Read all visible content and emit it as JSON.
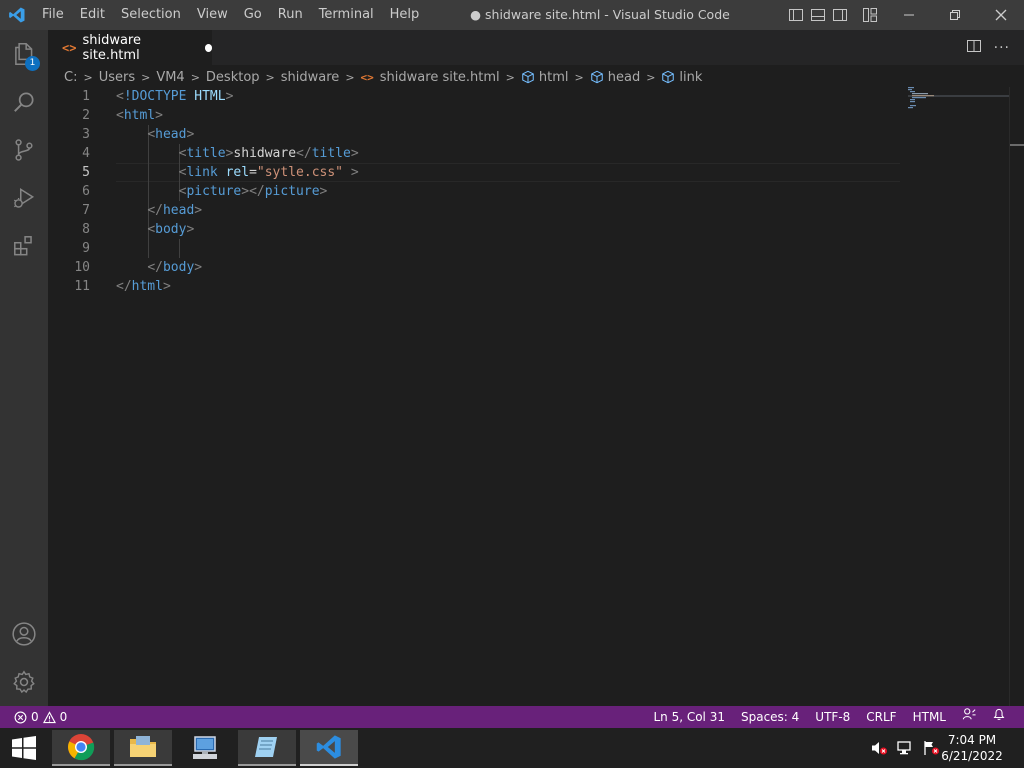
{
  "window": {
    "title": "● shidware site.html - Visual Studio Code",
    "menu": [
      "File",
      "Edit",
      "Selection",
      "View",
      "Go",
      "Run",
      "Terminal",
      "Help"
    ]
  },
  "activity_bar": {
    "explorer_badge": "1"
  },
  "tabs": [
    {
      "label": "shidware site.html",
      "icon": "<>"
    }
  ],
  "breadcrumb": {
    "path": [
      "C:",
      "Users",
      "VM4",
      "Desktop",
      "shidware"
    ],
    "file": "shidware site.html",
    "file_icon": "<>",
    "symbols": [
      "html",
      "head",
      "link"
    ]
  },
  "editor": {
    "active_line": 5,
    "lines": [
      {
        "n": "1",
        "tokens": [
          [
            "t-punct",
            "<"
          ],
          [
            "t-tag",
            "!DOCTYPE "
          ],
          [
            "t-attr",
            "HTML"
          ],
          [
            "t-punct",
            ">"
          ]
        ]
      },
      {
        "n": "2",
        "tokens": [
          [
            "t-punct",
            "<"
          ],
          [
            "t-tag",
            "html"
          ],
          [
            "t-punct",
            ">"
          ]
        ]
      },
      {
        "n": "3",
        "tokens": [
          [
            "t-text",
            "    "
          ],
          [
            "t-punct",
            "<"
          ],
          [
            "t-tag",
            "head"
          ],
          [
            "t-punct",
            ">"
          ]
        ]
      },
      {
        "n": "4",
        "tokens": [
          [
            "t-text",
            "        "
          ],
          [
            "t-punct",
            "<"
          ],
          [
            "t-tag",
            "title"
          ],
          [
            "t-punct",
            ">"
          ],
          [
            "t-text",
            "shidware"
          ],
          [
            "t-punct",
            "</"
          ],
          [
            "t-tag",
            "title"
          ],
          [
            "t-punct",
            ">"
          ]
        ]
      },
      {
        "n": "5",
        "tokens": [
          [
            "t-text",
            "        "
          ],
          [
            "t-punct",
            "<"
          ],
          [
            "t-tag",
            "link "
          ],
          [
            "t-attr",
            "rel"
          ],
          [
            "t-text",
            "="
          ],
          [
            "t-str",
            "\"sytle.css\""
          ],
          [
            "t-text",
            " "
          ],
          [
            "t-punct",
            ">"
          ]
        ]
      },
      {
        "n": "6",
        "tokens": [
          [
            "t-text",
            "        "
          ],
          [
            "t-punct",
            "<"
          ],
          [
            "t-tag",
            "picture"
          ],
          [
            "t-punct",
            "></"
          ],
          [
            "t-tag",
            "picture"
          ],
          [
            "t-punct",
            ">"
          ]
        ]
      },
      {
        "n": "7",
        "tokens": [
          [
            "t-text",
            "    "
          ],
          [
            "t-punct",
            "</"
          ],
          [
            "t-tag",
            "head"
          ],
          [
            "t-punct",
            ">"
          ]
        ]
      },
      {
        "n": "8",
        "tokens": [
          [
            "t-text",
            "    "
          ],
          [
            "t-punct",
            "<"
          ],
          [
            "t-tag",
            "body"
          ],
          [
            "t-punct",
            ">"
          ]
        ]
      },
      {
        "n": "9",
        "tokens": []
      },
      {
        "n": "10",
        "tokens": [
          [
            "t-text",
            "    "
          ],
          [
            "t-punct",
            "</"
          ],
          [
            "t-tag",
            "body"
          ],
          [
            "t-punct",
            ">"
          ]
        ]
      },
      {
        "n": "11",
        "tokens": [
          [
            "t-punct",
            "</"
          ],
          [
            "t-tag",
            "html"
          ],
          [
            "t-punct",
            ">"
          ]
        ]
      }
    ]
  },
  "status": {
    "errors": "0",
    "warnings": "0",
    "position": "Ln 5, Col 31",
    "spaces": "Spaces: 4",
    "encoding": "UTF-8",
    "eol": "CRLF",
    "language": "HTML"
  },
  "taskbar": {
    "time": "7:04 PM",
    "date": "6/21/2022"
  },
  "colors": {
    "statusbar": "#68217a",
    "titlebar": "#3c3c3c",
    "activitybar": "#333333",
    "editor_bg": "#1e1e1e"
  }
}
